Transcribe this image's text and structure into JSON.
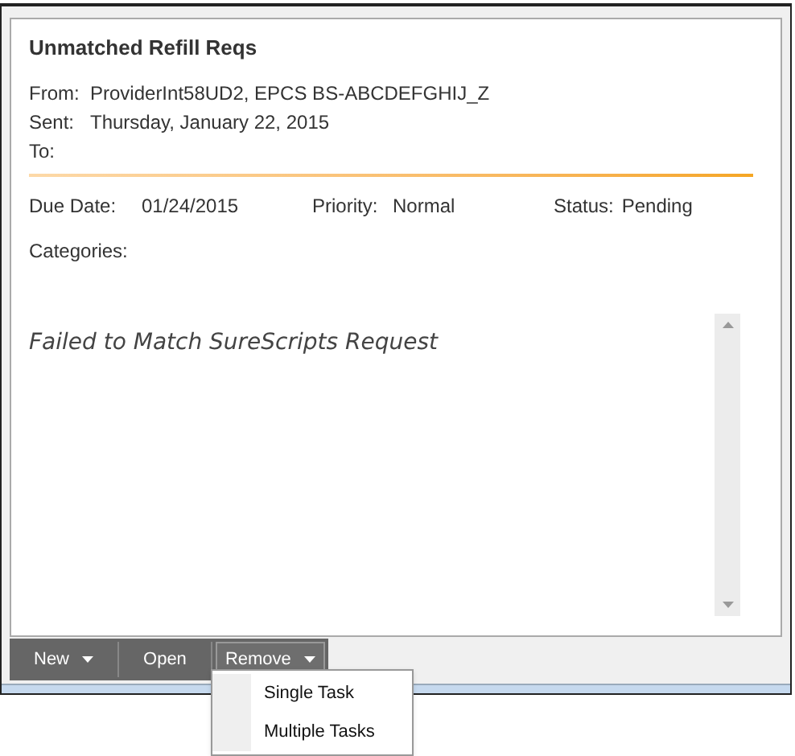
{
  "message": {
    "title": "Unmatched Refill Reqs",
    "headers": [
      {
        "label": "From:",
        "value": "ProviderInt58UD2, EPCS BS-ABCDEFGHIJ_Z"
      },
      {
        "label": "Sent:",
        "value": "Thursday, January 22, 2015"
      },
      {
        "label": "To:"
      }
    ],
    "due_date": {
      "label": "Due Date:",
      "value": "01/24/2015"
    },
    "priority": {
      "label": "Priority:",
      "value": "Normal"
    },
    "status": {
      "label": "Status:",
      "value": "Pending"
    },
    "categories": {
      "label": "Categories:"
    },
    "body": "Failed to Match SureScripts Request"
  },
  "toolbar": [
    {
      "label": "New",
      "dropdown": true,
      "expanded": false
    },
    {
      "label": "Open",
      "dropdown": false,
      "expanded": false
    },
    {
      "label": "Remove",
      "dropdown": true,
      "expanded": true,
      "menu": [
        "Single Task",
        "Multiple Tasks"
      ]
    }
  ]
}
